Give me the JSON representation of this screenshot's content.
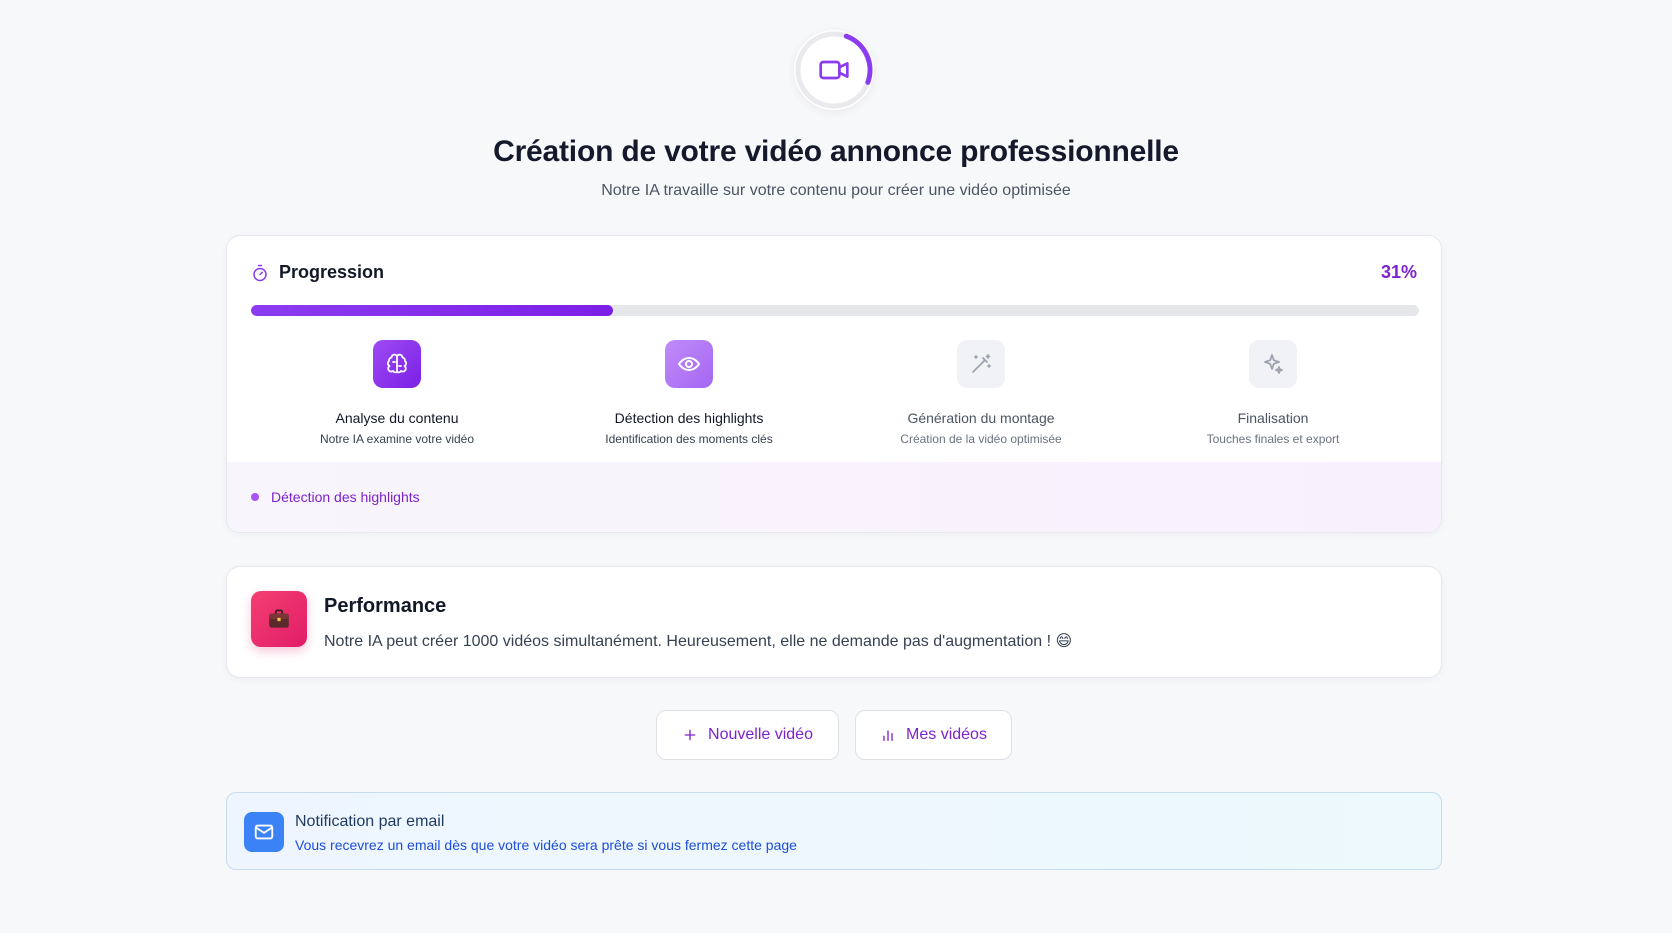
{
  "header": {
    "title": "Création de votre vidéo annonce professionnelle",
    "subtitle": "Notre IA travaille sur votre contenu pour créer une vidéo optimisée",
    "icon": "video-camera-icon"
  },
  "progress": {
    "label": "Progression",
    "percent_text": "31%",
    "value": 0.31,
    "icon": "timer-icon",
    "steps": [
      {
        "name": "Analyse du contenu",
        "desc": "Notre IA examine votre vidéo",
        "state": "done",
        "icon": "brain-icon"
      },
      {
        "name": "Détection des highlights",
        "desc": "Identification des moments clés",
        "state": "active",
        "icon": "eye-icon"
      },
      {
        "name": "Génération du montage",
        "desc": "Création de la vidéo optimisée",
        "state": "todo",
        "icon": "magic-wand-icon"
      },
      {
        "name": "Finalisation",
        "desc": "Touches finales et export",
        "state": "todo",
        "icon": "sparkles-icon"
      }
    ],
    "current_status": "Détection des highlights"
  },
  "performance": {
    "title": "Performance",
    "text": "Notre IA peut créer 1000 vidéos simultanément. Heureusement, elle ne demande pas d'augmentation ! 😄",
    "icon": "briefcase-icon"
  },
  "actions": {
    "new_video": "Nouvelle vidéo",
    "my_videos": "Mes vidéos"
  },
  "notice": {
    "title": "Notification par email",
    "text": "Vous recevrez un email dès que votre vidéo sera prête si vous fermez cette page",
    "icon": "mail-icon"
  },
  "colors": {
    "accent": "#7e22ce",
    "progress_fill": "#8b3cf0",
    "performance_icon_bg": "#e11d68",
    "notice_icon_bg": "#3b82f6"
  }
}
